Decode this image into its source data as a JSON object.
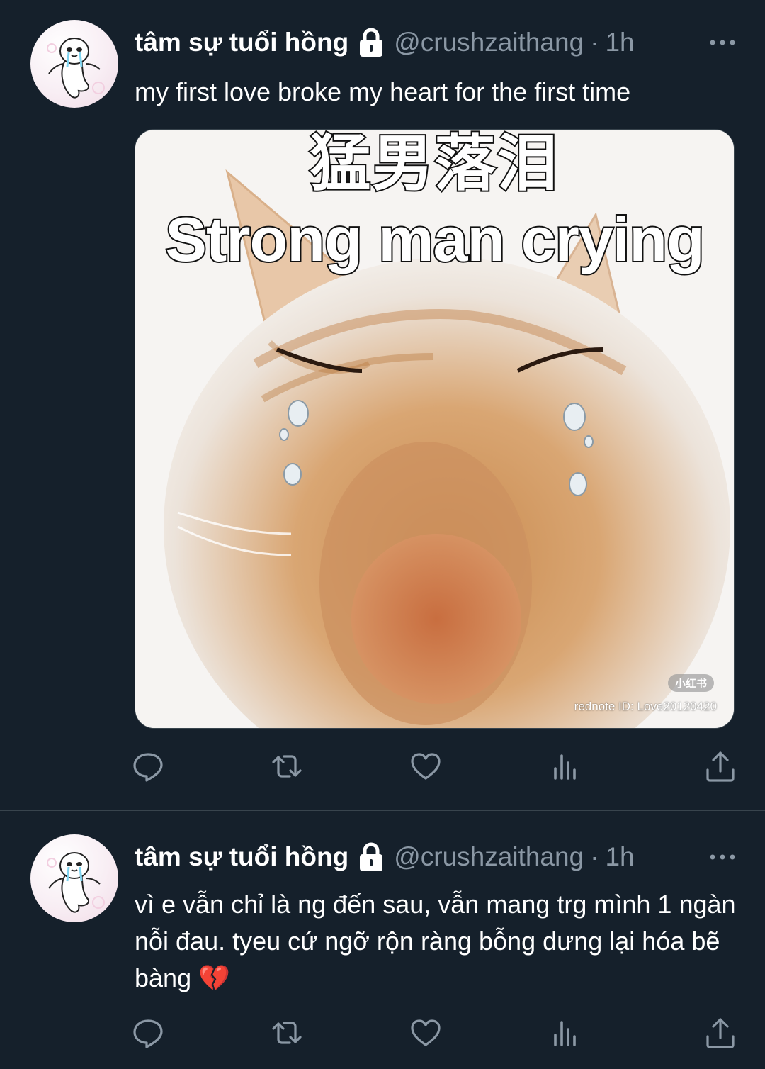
{
  "tweets": [
    {
      "author": {
        "display_name": "tâm sự tuổi hồng",
        "handle": "@crushzaithang",
        "protected_icon": "lock-icon",
        "avatar_icon": "crying-seal-avatar"
      },
      "separator": "·",
      "time": "1h",
      "text": "my first love broke my heart for the first time",
      "media": {
        "caption_zh": "猛男落泪",
        "caption_en": "Strong man crying",
        "badge": "小红书",
        "watermark": "rednote ID:  Love20120420"
      },
      "actions": [
        "reply-icon",
        "retweet-icon",
        "like-icon",
        "views-icon",
        "share-icon"
      ],
      "more_icon": "more-icon"
    },
    {
      "author": {
        "display_name": "tâm sự tuổi hồng",
        "handle": "@crushzaithang",
        "protected_icon": "lock-icon",
        "avatar_icon": "crying-seal-avatar"
      },
      "separator": "·",
      "time": "1h",
      "text": "vì e vẫn chỉ là ng đến sau, vẫn mang trg mình 1 ngàn nỗi đau. tyeu cứ ngỡ rộn ràng bỗng dưng lại hóa bẽ bàng 💔",
      "actions": [
        "reply-icon",
        "retweet-icon",
        "like-icon",
        "views-icon",
        "share-icon"
      ],
      "more_icon": "more-icon"
    }
  ],
  "colors": {
    "background": "#15202b",
    "secondary_text": "#8b98a5",
    "divider": "#38444d"
  }
}
